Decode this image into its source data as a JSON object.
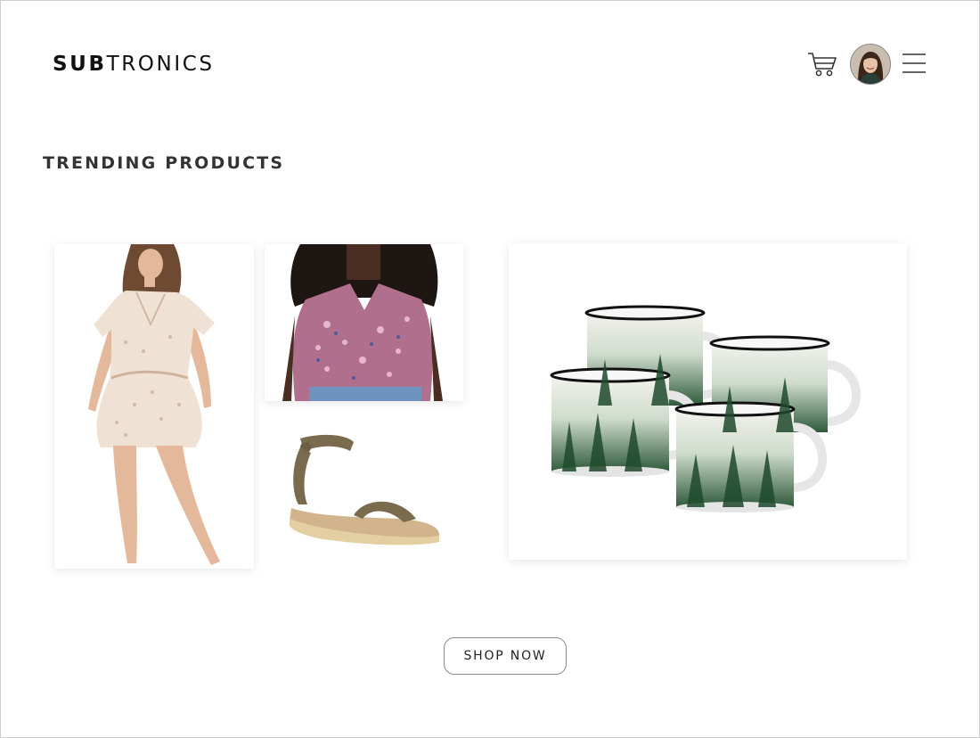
{
  "brand": {
    "bold": "SUB",
    "light": "TRONICS"
  },
  "header": {
    "cart_icon": "cart-icon",
    "menu_icon": "hamburger-menu-icon",
    "avatar": "user-avatar"
  },
  "section": {
    "title": "TRENDING PRODUCTS"
  },
  "products": [
    {
      "name": "dress"
    },
    {
      "name": "floral-top"
    },
    {
      "name": "sandal"
    },
    {
      "name": "forest-mugs-set"
    }
  ],
  "cta": {
    "label": "SHOP NOW"
  },
  "colors": {
    "text": "#111111",
    "border": "#8a8a8a",
    "mug_green": "#2f5a3a"
  }
}
